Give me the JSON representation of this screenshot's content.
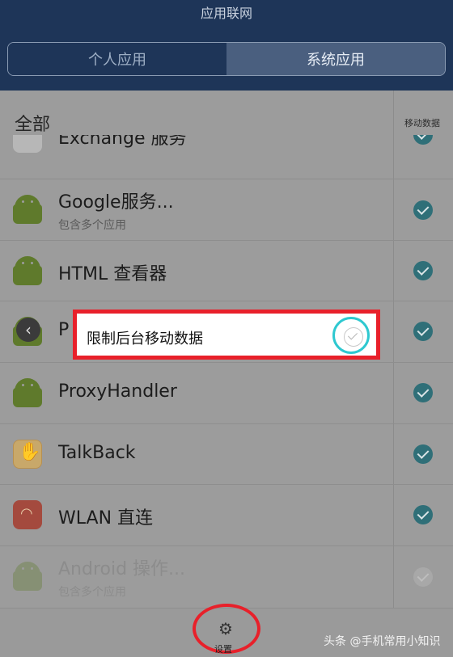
{
  "topbar": {
    "title": "应用联网",
    "tabs": [
      "个人应用",
      "系统应用"
    ]
  },
  "list": {
    "header_all": "全部",
    "column_header": "移动数据",
    "rows": [
      {
        "name": "Exchange 服务",
        "sub": "",
        "checked": true
      },
      {
        "name": "Google服务...",
        "sub": "包含多个应用",
        "checked": true
      },
      {
        "name": "HTML 查看器",
        "sub": "",
        "checked": true
      },
      {
        "name": "P",
        "sub": "",
        "checked": true
      },
      {
        "name": "ProxyHandler",
        "sub": "",
        "checked": true
      },
      {
        "name": "TalkBack",
        "sub": "",
        "checked": true
      },
      {
        "name": "WLAN 直连",
        "sub": "",
        "checked": true
      },
      {
        "name": "Android 操作...",
        "sub": "包含多个应用",
        "checked": false
      }
    ]
  },
  "popup": {
    "text": "限制后台移动数据",
    "checked": false
  },
  "bottom": {
    "settings_label": "设置"
  },
  "watermark": "头条 @手机常用小知识",
  "colors": {
    "topbar": "#1e3558",
    "highlight": "#e8202a",
    "check": "#2f6f78",
    "ring": "#2ec8d0"
  }
}
